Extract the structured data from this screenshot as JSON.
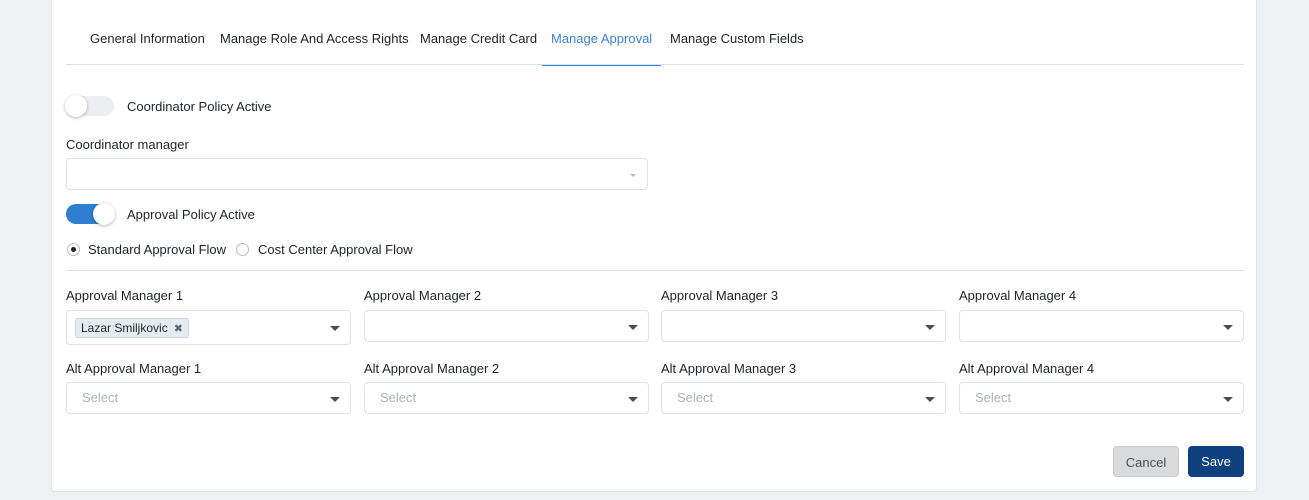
{
  "tabs": [
    {
      "label": "General Information"
    },
    {
      "label": "Manage Role And Access Rights"
    },
    {
      "label": "Manage Credit Card"
    },
    {
      "label": "Manage Approval",
      "active": true
    },
    {
      "label": "Manage Custom Fields"
    }
  ],
  "coordinator": {
    "toggle_label": "Coordinator Policy Active",
    "toggle_on": false,
    "manager_label": "Coordinator manager",
    "manager_value": ""
  },
  "approval": {
    "toggle_label": "Approval Policy Active",
    "toggle_on": true,
    "flow_options": [
      {
        "label": "Standard Approval Flow",
        "checked": true
      },
      {
        "label": "Cost Center Approval Flow",
        "checked": false
      }
    ],
    "managers": [
      {
        "label": "Approval Manager 1",
        "selected": [
          "Lazar Smiljkovic"
        ]
      },
      {
        "label": "Approval Manager 2",
        "selected": []
      },
      {
        "label": "Approval Manager 3",
        "selected": []
      },
      {
        "label": "Approval Manager 4",
        "selected": []
      }
    ],
    "alt_managers": [
      {
        "label": "Alt Approval Manager 1",
        "placeholder": "Select"
      },
      {
        "label": "Alt Approval Manager 2",
        "placeholder": "Select"
      },
      {
        "label": "Alt Approval Manager 3",
        "placeholder": "Select"
      },
      {
        "label": "Alt Approval Manager 4",
        "placeholder": "Select"
      }
    ],
    "chip_remove_glyph": "✖"
  },
  "actions": {
    "cancel_label": "Cancel",
    "save_label": "Save"
  },
  "colors": {
    "accent": "#3b82d8",
    "toggle_on": "#2f7fd0",
    "save_button": "#0e3f7e",
    "cancel_button": "#d9dadc"
  }
}
